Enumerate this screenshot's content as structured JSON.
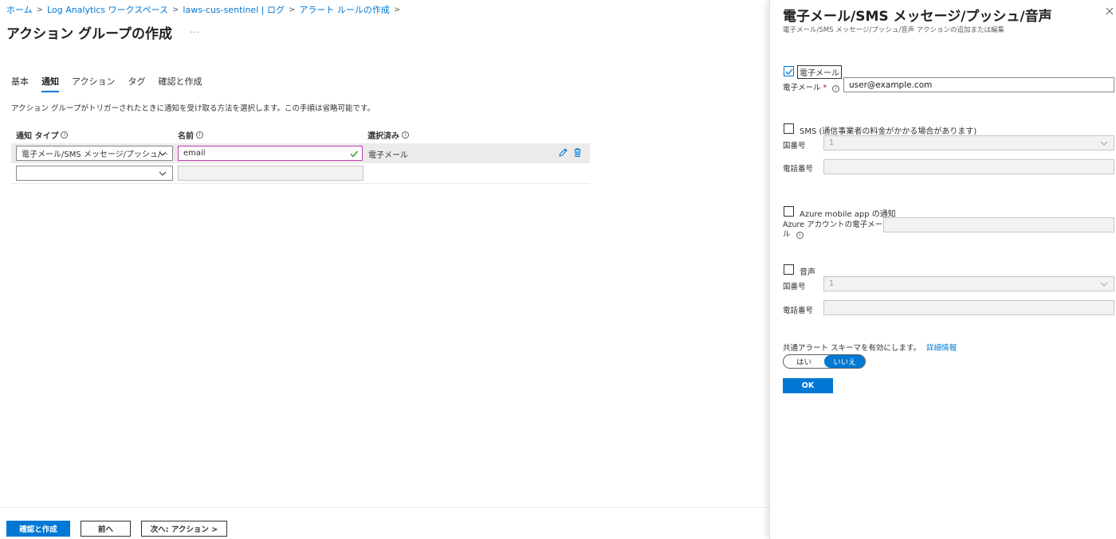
{
  "breadcrumb": [
    "ホーム",
    "Log Analytics ワークスペース",
    "laws-cus-sentinel | ログ",
    "アラート ルールの作成"
  ],
  "page": {
    "title": "アクション グループの作成",
    "more": "···"
  },
  "tabs": [
    "基本",
    "通知",
    "アクション",
    "タグ",
    "確認と作成"
  ],
  "active_tab": "通知",
  "description": "アクション グループがトリガーされたときに通知を受け取る方法を選択します。この手順は省略可能です。",
  "grid": {
    "headers": {
      "type": "通知 タイプ",
      "name": "名前",
      "selected": "選択済み"
    },
    "rows": [
      {
        "type": "電子メール/SMS メッセージ/プッシュ/···",
        "name": "email",
        "selected": "電子メール"
      },
      {
        "type": "",
        "name": "",
        "selected": ""
      }
    ]
  },
  "footer": {
    "review_create": "確認と作成",
    "previous": "前へ",
    "next": "次へ: アクション >"
  },
  "panel": {
    "title": "電子メール/SMS メッセージ/プッシュ/音声",
    "subtitle": "電子メール/SMS メッセージ/プッシュ/音声 アクションの追加または編集",
    "email": {
      "checkbox_label": "電子メール",
      "field_label": "電子メール",
      "required_mark": "*",
      "value": "user@example.com"
    },
    "sms": {
      "checkbox_label": "SMS (通信事業者の料金がかかる場合があります)",
      "country_label": "国番号",
      "country_value": "1",
      "phone_label": "電話番号"
    },
    "azure_app": {
      "checkbox_label": "Azure mobile app の通知",
      "field_label_line1": "Azure アカウントの電子メー",
      "field_label_line2": "ル"
    },
    "voice": {
      "checkbox_label": "音声",
      "country_label": "国番号",
      "country_value": "1",
      "phone_label": "電話番号"
    },
    "schema": {
      "text": "共通アラート スキーマを有効にします。",
      "link": "詳細情報",
      "yes": "はい",
      "no": "いいえ",
      "selected": "いいえ"
    },
    "ok": "OK"
  },
  "colors": {
    "accent": "#0078d4",
    "focus_border": "#c239b3",
    "selected_row": "#edebe9",
    "success_check": "#107c10"
  }
}
